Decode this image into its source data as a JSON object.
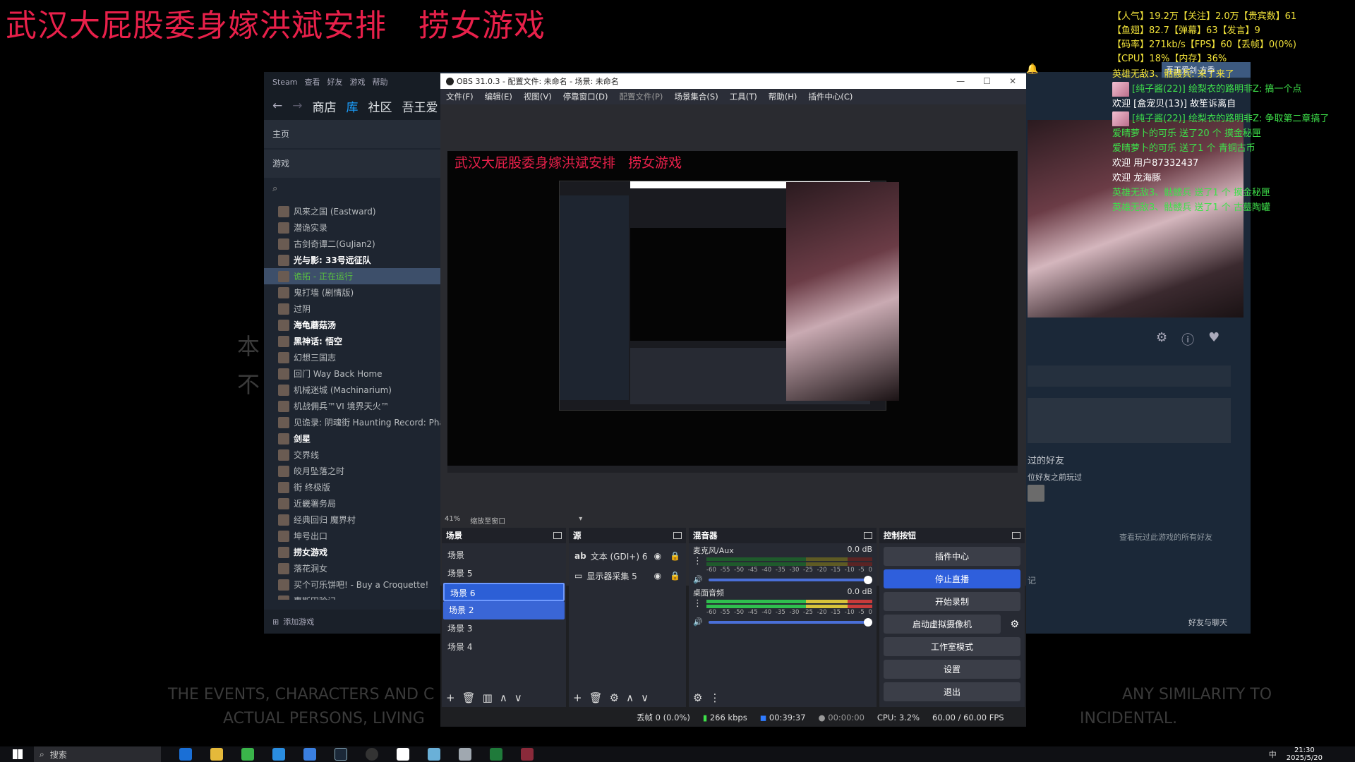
{
  "overlay": {
    "title": "武汉大屁股委身嫁洪斌安排   捞女游戏",
    "stats": [
      "【人气】19.2万【关注】2.0万【贵宾数】61",
      "【鱼翅】82.7【弹幕】63【发言】9",
      "【码率】271kb/s【FPS】60【丢帧】0(0%)",
      "【CPU】18%【内存】36%"
    ],
    "chat": [
      {
        "text": "英雄无敌3、骷髅兵: 来了来了",
        "color": "y"
      },
      {
        "text": "[纯子酱(22)] 绘梨衣的路明非Z: 搞一个点",
        "color": "g",
        "avatar": true
      },
      {
        "text": "欢迎 [盒宠贝(13)] 故笙诉离自",
        "color": "w"
      },
      {
        "text": "[纯子酱(22)] 绘梨衣的路明非Z: 争取第二章搞了",
        "color": "g",
        "avatar": true
      },
      {
        "text": "爱晴萝卜的可乐 送了20 个 摸金秘匣",
        "color": "g"
      },
      {
        "text": "爱晴萝卜的可乐 送了1 个 青铜古币",
        "color": "g"
      },
      {
        "text": "欢迎 用户87332437",
        "color": "w"
      },
      {
        "text": "欢迎 龙海豚",
        "color": "w"
      },
      {
        "text": "英雄无敌3、骷髅兵 送了1 个 摸金秘匣",
        "color": "g"
      },
      {
        "text": "英雄无敌3、骷髅兵 送了1 个 古墓陶罐",
        "color": "g"
      }
    ],
    "watermark_cn_1": "本",
    "watermark_cn_2": "不",
    "watermark_left_1": "THE EVENTS, CHARACTERS AND C",
    "watermark_left_2": "ACTUAL PERSONS, LIVING",
    "watermark_right_1": "ANY SIMILARITY TO",
    "watermark_right_2": "INCIDENTAL."
  },
  "steam": {
    "menu": [
      "Steam",
      "查看",
      "好友",
      "游戏",
      "帮助"
    ],
    "nav": [
      "商店",
      "库",
      "社区",
      "吾王爱"
    ],
    "home": "主页",
    "games_header": "游戏",
    "games": [
      {
        "name": "风来之国 (Eastward)"
      },
      {
        "name": "潜诡实录"
      },
      {
        "name": "古剑奇谭二(GuJian2)"
      },
      {
        "name": "光与影: 33号远征队",
        "bold": true
      },
      {
        "name": "诡拓 - 正在运行",
        "selected": true
      },
      {
        "name": "鬼打墙 (剧情版)"
      },
      {
        "name": "过阴"
      },
      {
        "name": "海龟蘑菇汤",
        "bold": true
      },
      {
        "name": "黑神话: 悟空",
        "bold": true
      },
      {
        "name": "幻想三国志"
      },
      {
        "name": "回门 Way Back Home"
      },
      {
        "name": "机械迷城 (Machinarium)"
      },
      {
        "name": "机战佣兵™VI 境界天火™"
      },
      {
        "name": "见诡录: 阴魂街 Haunting Record: Phant"
      },
      {
        "name": "剑星",
        "bold": true
      },
      {
        "name": "交界线"
      },
      {
        "name": "皎月坠落之时"
      },
      {
        "name": "街 终极版"
      },
      {
        "name": "近畿署务局"
      },
      {
        "name": "经典回归 魔界村"
      },
      {
        "name": "坤号出口"
      },
      {
        "name": "捞女游戏",
        "bold": true
      },
      {
        "name": "落花洞女"
      },
      {
        "name": "买个可乐饼吧! - Buy a Croquette!"
      },
      {
        "name": "惠斯田验记"
      }
    ],
    "add_game": "添加游戏",
    "right_user": "吾王爱剑·方季",
    "friends_played": "过的好友",
    "friends_before": "位好友之前玩过",
    "see_all_friends": "查看玩过此游戏的所有好友",
    "friends_chat": "好友与聊天",
    "notes": "记"
  },
  "obs": {
    "title": "OBS 31.0.3 - 配置文件: 未命名 - 场景: 未命名",
    "menu": [
      "文件(F)",
      "编辑(E)",
      "视图(V)",
      "停靠窗口(D)",
      "配置文件(P)",
      "场景集合(S)",
      "工具(T)",
      "帮助(H)",
      "插件中心(C)"
    ],
    "canvas_title": "武汉大屁股委身嫁洪斌安排   捞女游戏",
    "zoom": "41%",
    "zoom_mode": "缩放至窗口",
    "scenes_header": "场景",
    "scenes": [
      {
        "name": "场景"
      },
      {
        "name": "场景 5"
      },
      {
        "name": "场景 6",
        "state": "sel"
      },
      {
        "name": "场景 2",
        "state": "hover"
      },
      {
        "name": "场景 3"
      },
      {
        "name": "场景 4"
      }
    ],
    "sources_header": "源",
    "sources": [
      "文本 (GDI+) 6",
      "显示器采集 5"
    ],
    "mixer_header": "混音器",
    "mixer": [
      {
        "name": "麦克风/Aux",
        "db": "0.0 dB",
        "active": false
      },
      {
        "name": "桌面音频",
        "db": "0.0 dB",
        "active": true
      }
    ],
    "mixer_scale": [
      "-60",
      "-55",
      "-50",
      "-45",
      "-40",
      "-35",
      "-30",
      "-25",
      "-20",
      "-15",
      "-10",
      "-5",
      "0"
    ],
    "controls_header": "控制按钮",
    "controls": [
      {
        "label": "插件中心"
      },
      {
        "label": "停止直播",
        "primary": true
      },
      {
        "label": "开始录制"
      },
      {
        "label": "启动虚拟摄像机"
      },
      {
        "label": "工作室模式"
      },
      {
        "label": "设置"
      },
      {
        "label": "退出"
      }
    ],
    "status": {
      "dropped": "丢帧 0 (0.0%)",
      "bitrate": "266 kbps",
      "live_time": "00:39:37",
      "rec_time": "00:00:00",
      "cpu": "CPU: 3.2%",
      "fps": "60.00 / 60.00 FPS"
    }
  },
  "taskbar": {
    "search": "搜索",
    "time": "21:30",
    "date": "2025/5/20",
    "ime": "中"
  }
}
